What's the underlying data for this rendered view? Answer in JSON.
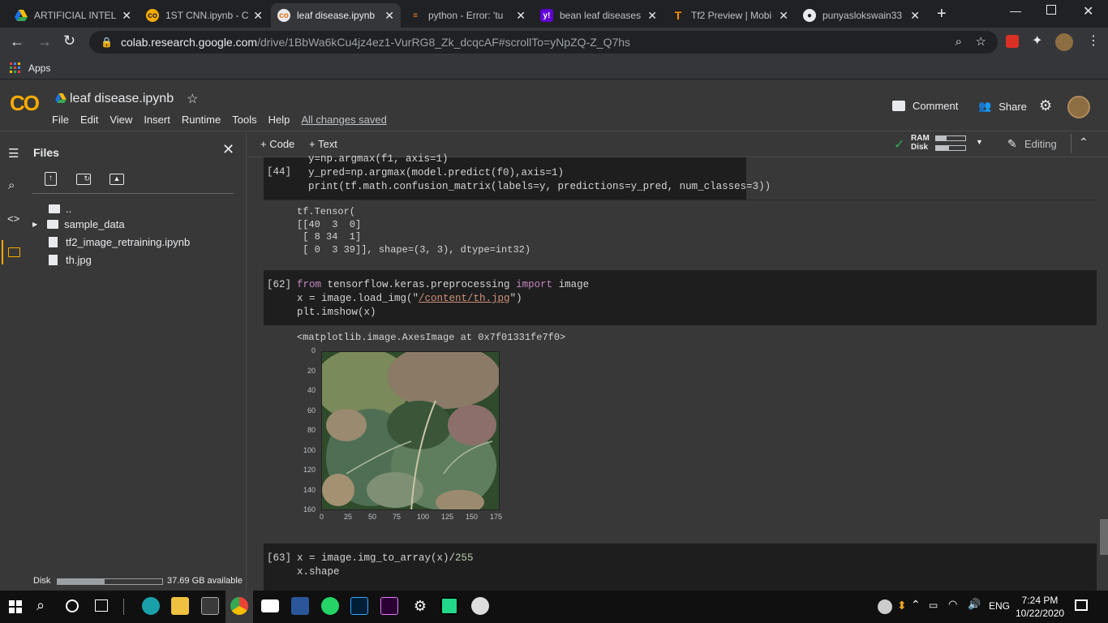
{
  "browser": {
    "tabs": [
      {
        "title": "ARTIFICIAL INTELLI",
        "active": false
      },
      {
        "title": "1ST CNN.ipynb - C",
        "active": false
      },
      {
        "title": "leaf disease.ipynb",
        "active": true
      },
      {
        "title": "python - Error: 'tu",
        "active": false
      },
      {
        "title": "bean leaf diseases",
        "active": false
      },
      {
        "title": "Tf2 Preview | Mobi",
        "active": false
      },
      {
        "title": "punyaslokswain33",
        "active": false
      }
    ],
    "url_host": "colab.research.google.com",
    "url_path": "/drive/1BbWa6kCu4jz4ez1-VurRG8_Zk_dcqcAF#scrollTo=yNpZQ-Z_Q7hs",
    "bookmarks_label": "Apps"
  },
  "colab": {
    "logo": "CO",
    "notebook_title": "leaf disease.ipynb",
    "menu": [
      "File",
      "Edit",
      "View",
      "Insert",
      "Runtime",
      "Tools",
      "Help"
    ],
    "save_status": "All changes saved",
    "comment_label": "Comment",
    "share_label": "Share",
    "toolbar": {
      "code_label": "+ Code",
      "text_label": "+ Text",
      "ram_label": "RAM",
      "disk_label": "Disk",
      "editing_label": "Editing"
    }
  },
  "sidebar": {
    "title": "Files",
    "files": [
      {
        "name": "..",
        "type": "parent"
      },
      {
        "name": "sample_data",
        "type": "folder"
      },
      {
        "name": "tf2_image_retraining.ipynb",
        "type": "file"
      },
      {
        "name": "th.jpg",
        "type": "file"
      }
    ],
    "disk_label": "Disk",
    "disk_available": "37.69 GB available",
    "disk_used_fraction": 0.45
  },
  "cells": {
    "c44": {
      "prompt": "[44]",
      "line0": "y=np.argmax(f1, axis=1)",
      "line1": "y_pred=np.argmax(model.predict(f0),axis=1)",
      "line2": "print(tf.math.confusion_matrix(labels=y, predictions=y_pred, num_classes=3))",
      "output": "tf.Tensor(\n[[40  3  0]\n [ 8 34  1]\n [ 0  3 39]], shape=(3, 3), dtype=int32)"
    },
    "c62": {
      "prompt": "[62]",
      "l1_kw1": "from",
      "l1_mod": " tensorflow.keras.preprocessing ",
      "l1_kw2": "import",
      "l1_rest": " image",
      "l2_pre": "x = image.load_img(\"",
      "l2_str": "/content/th.jpg",
      "l2_post": "\")",
      "l3": "plt.imshow(x)",
      "output": "<matplotlib.image.AxesImage at 0x7f01331fe7f0>",
      "yticks": [
        "0",
        "20",
        "40",
        "60",
        "80",
        "100",
        "120",
        "140",
        "160"
      ],
      "xticks": [
        "0",
        "25",
        "50",
        "75",
        "100",
        "125",
        "150",
        "175"
      ]
    },
    "c63": {
      "prompt": "[63]",
      "l1_pre": "x = image.img_to_array(x)/",
      "l1_num": "255",
      "l2": "x.shape"
    }
  },
  "taskbar": {
    "time": "7:24 PM",
    "date": "10/22/2020",
    "lang": "ENG"
  },
  "colors": {
    "colab_orange": "#f9ab00",
    "check_green": "#34a853"
  }
}
